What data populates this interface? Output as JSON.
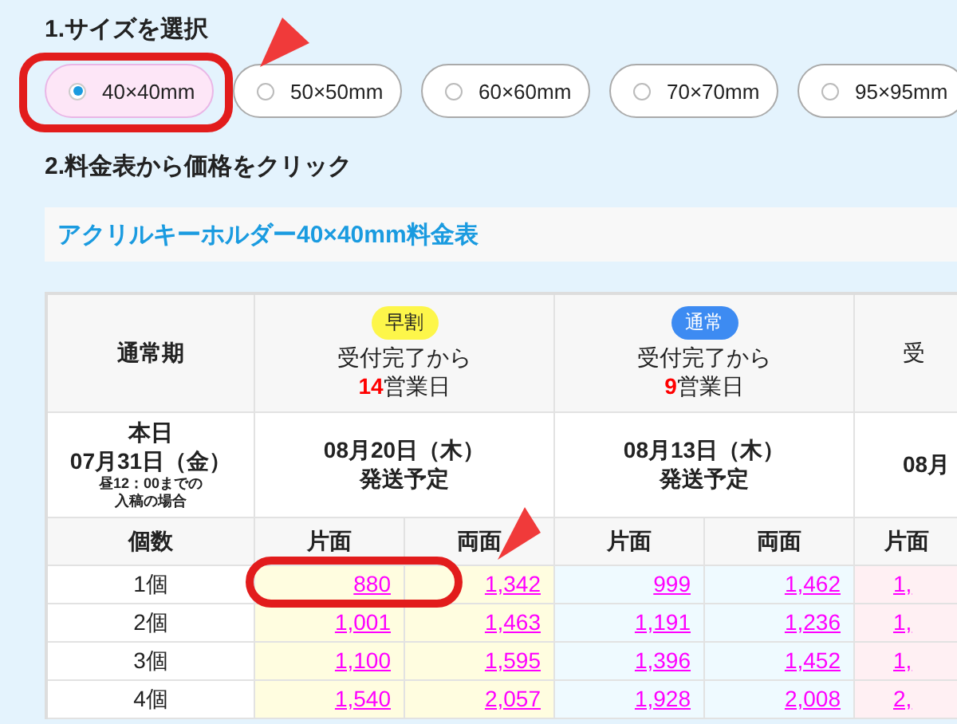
{
  "step1": {
    "heading": "1.サイズを選択",
    "sizes": [
      {
        "label": "40×40mm",
        "selected": true
      },
      {
        "label": "50×50mm",
        "selected": false
      },
      {
        "label": "60×60mm",
        "selected": false
      },
      {
        "label": "70×70mm",
        "selected": false
      },
      {
        "label": "95×95mm",
        "selected": false
      }
    ]
  },
  "step2": {
    "heading": "2.料金表から価格をクリック"
  },
  "price_table": {
    "title": "アクリルキーホルダー40×40mm料金表",
    "corner": "通常期",
    "today": {
      "label": "本日",
      "date": "07月31日（金）",
      "note_1": "昼12：00までの",
      "note_2": "入稿の場合"
    },
    "plans": [
      {
        "badge": "早割",
        "color": "#fdf64a",
        "lead": "受付完了から",
        "days": "14",
        "days_unit": "営業日",
        "ship_date": "08月20日（木）",
        "ship_label": "発送予定"
      },
      {
        "badge": "通常",
        "color": "#3d8bf2",
        "lead": "受付完了から",
        "days": "9",
        "days_unit": "営業日",
        "ship_date": "08月13日（木）",
        "ship_label": "発送予定"
      },
      {
        "lead": "受",
        "ship_date": "08月"
      }
    ],
    "qty_header": "個数",
    "sides": [
      "片面",
      "両面",
      "片面",
      "両面",
      "片面"
    ],
    "rows": [
      {
        "qty": "1個",
        "prices": [
          "880",
          "1,342",
          "999",
          "1,462",
          "1,"
        ]
      },
      {
        "qty": "2個",
        "prices": [
          "1,001",
          "1,463",
          "1,191",
          "1,236",
          "1,"
        ]
      },
      {
        "qty": "3個",
        "prices": [
          "1,100",
          "1,595",
          "1,396",
          "1,452",
          "1,"
        ]
      },
      {
        "qty": "4個",
        "prices": [
          "1,540",
          "2,057",
          "1,928",
          "2,008",
          "2,"
        ]
      }
    ]
  }
}
